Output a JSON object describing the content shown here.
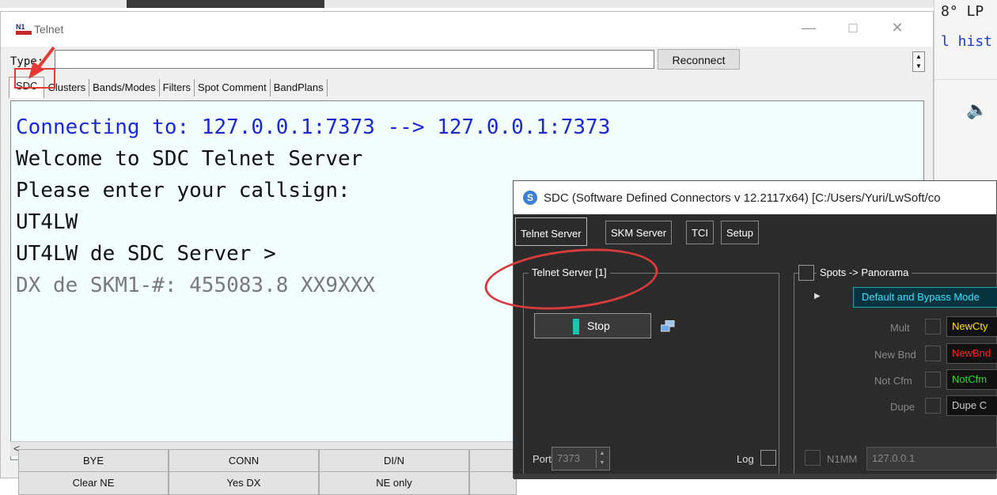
{
  "background": {
    "line1": "8° LP",
    "line2": "l hist"
  },
  "telnet": {
    "title": "Telnet",
    "type_label": "Type:",
    "type_value": "",
    "reconnect_label": "Reconnect",
    "tabs": [
      "SDC",
      "Clusters",
      "Bands/Modes",
      "Filters",
      "Spot Comment",
      "BandPlans"
    ],
    "console_lines": [
      {
        "text": "Connecting to: 127.0.0.1:7373 --> 127.0.0.1:7373",
        "color": "#1a28d8"
      },
      {
        "text": "Welcome to SDC Telnet Server",
        "color": "#111111"
      },
      {
        "text": "Please enter your callsign:",
        "color": "#111111"
      },
      {
        "text": "UT4LW",
        "color": "#111111"
      },
      {
        "text": "UT4LW de SDC Server >",
        "color": "#111111"
      },
      {
        "text": "DX de SKM1-#:   455083.8  XX9XXX",
        "color": "#7a7a7a"
      }
    ],
    "macro_row1": [
      "BYE",
      "CONN",
      "DI/N"
    ],
    "macro_row2": [
      "Clear NE",
      "Yes DX",
      "NE only"
    ]
  },
  "sdc": {
    "title": "SDC (Software Defined Connectors v 12.2117x64) [C:/Users/Yuri/LwSoft/co",
    "tabs": [
      "Telnet Server",
      "SKM Server",
      "TCI",
      "Setup"
    ],
    "group_title": "Telnet Server [1]",
    "stop_label": "Stop",
    "port_label": "Port:",
    "port_value": "7373",
    "log_label": "Log",
    "spots_label": "Spots -> Panorama",
    "mode_value": "Default and Bypass Mode",
    "rows": [
      {
        "label": "Mult",
        "value": "NewCty",
        "color": "#ffe100"
      },
      {
        "label": "New Bnd",
        "value": "NewBnd",
        "color": "#ff2020"
      },
      {
        "label": "Not Cfm",
        "value": "NotCfm",
        "color": "#22e022"
      },
      {
        "label": "Dupe",
        "value": "Dupe C",
        "color": "#cccccc"
      }
    ],
    "n1mm_label": "N1MM",
    "n1mm_ip": "127.0.0.1"
  },
  "colors": {
    "annotation_red": "#e53935",
    "console_bg": "#f2fffe",
    "sdc_bg": "#2b2b2b"
  }
}
